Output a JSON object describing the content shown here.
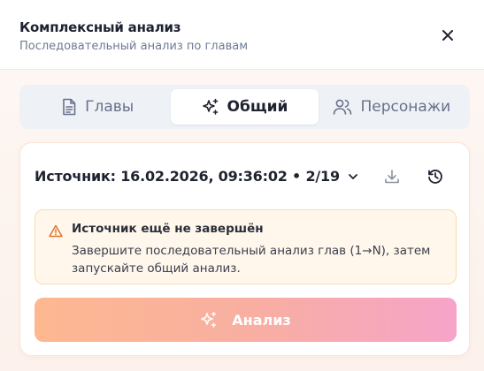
{
  "dialog": {
    "title": "Комплексный анализ",
    "subtitle": "Последовательный анализ по главам"
  },
  "tabs": [
    {
      "label": "Главы",
      "icon": "document-icon",
      "active": false
    },
    {
      "label": "Общий",
      "icon": "sparkles-icon",
      "active": true
    },
    {
      "label": "Персонажи",
      "icon": "users-icon",
      "active": false
    }
  ],
  "source": {
    "label": "Источник: 16.02.2026, 09:36:02 • 2/19",
    "dropdown_icon": "chevron-down-icon",
    "actions": [
      "download-icon",
      "history-icon"
    ]
  },
  "warning": {
    "icon": "warning-triangle-icon",
    "title": "Источник ещё не завершён",
    "body": "Завершите последовательный анализ глав (1→N), затем запускайте общий анализ."
  },
  "analyze_button": {
    "label": "Анализ",
    "icon": "sparkles-icon",
    "disabled": true
  },
  "colors": {
    "accent_start": "#fdb48a",
    "accent_end": "#f59fc6",
    "warning_border": "#f6dcae",
    "warning_bg": "#fff7ec",
    "warning_icon": "#e0752a"
  }
}
